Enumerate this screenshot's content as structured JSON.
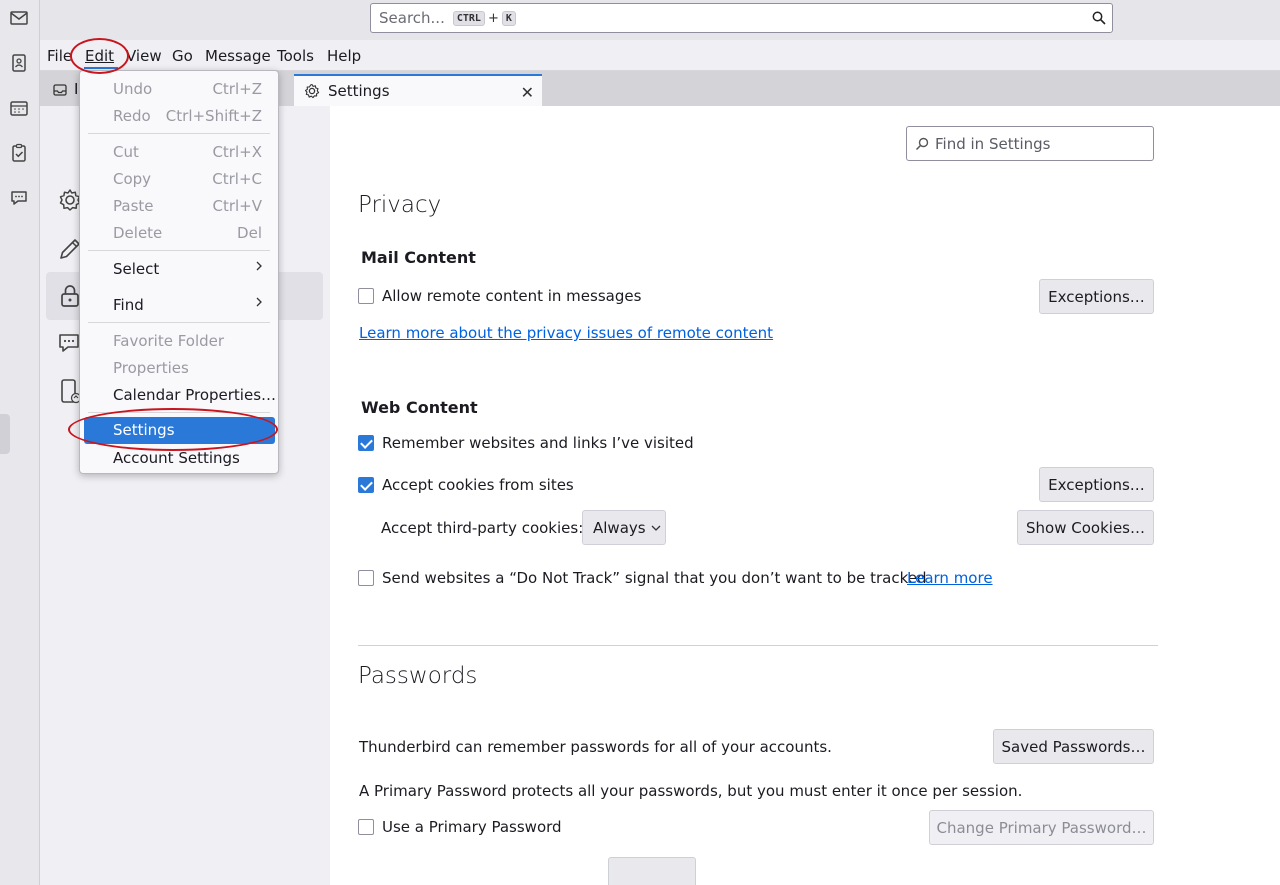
{
  "search": {
    "placeholder": "Search...",
    "key1": "CTRL",
    "plus": "+",
    "key2": "K"
  },
  "menubar": {
    "items": [
      {
        "label": "File"
      },
      {
        "label": "Edit"
      },
      {
        "label": "View"
      },
      {
        "label": "Go"
      },
      {
        "label": "Message"
      },
      {
        "label": "Tools"
      },
      {
        "label": "Help"
      }
    ]
  },
  "tabs": {
    "home_label": "I",
    "settings_label": "Settings",
    "close_glyph": "✕"
  },
  "edit_menu": {
    "undo": {
      "label": "Undo",
      "shortcut": "Ctrl+Z"
    },
    "redo": {
      "label": "Redo",
      "shortcut": "Ctrl+Shift+Z"
    },
    "cut": {
      "label": "Cut",
      "shortcut": "Ctrl+X"
    },
    "copy": {
      "label": "Copy",
      "shortcut": "Ctrl+C"
    },
    "paste": {
      "label": "Paste",
      "shortcut": "Ctrl+V"
    },
    "delete": {
      "label": "Delete",
      "shortcut": "Del"
    },
    "select": {
      "label": "Select"
    },
    "find": {
      "label": "Find"
    },
    "favorite_folder": {
      "label": "Favorite Folder"
    },
    "properties": {
      "label": "Properties"
    },
    "calendar_properties": {
      "label": "Calendar Properties…"
    },
    "settings": {
      "label": "Settings"
    },
    "account_settings": {
      "label": "Account Settings"
    }
  },
  "content": {
    "find_placeholder": "Find in Settings",
    "privacy": {
      "title": "Privacy",
      "mail_content": "Mail Content",
      "allow_remote": "Allow remote content in messages",
      "allow_remote_checked": false,
      "exceptions_label": "Exceptions…",
      "learn_more_remote": "Learn more about the privacy issues of remote content",
      "web_content": "Web Content",
      "remember_websites": "Remember websites and links I’ve visited",
      "remember_checked": true,
      "accept_cookies": "Accept cookies from sites",
      "accept_cookies_checked": true,
      "third_party_label": "Accept third-party cookies:",
      "third_party_value": "Always",
      "show_cookies": "Show Cookies…",
      "dnt_label": "Send websites a “Do Not Track” signal that you don’t want to be tracked",
      "dnt_checked": false,
      "learn_more": "Learn more"
    },
    "passwords": {
      "title": "Passwords",
      "remember_text": "Thunderbird can remember passwords for all of your accounts.",
      "saved_passwords": "Saved Passwords…",
      "primary_text": "A Primary Password protects all your passwords, but you must enter it once per session.",
      "use_primary": "Use a Primary Password",
      "use_primary_checked": false,
      "change_primary": "Change Primary Password…"
    }
  },
  "colors": {
    "accent": "#2a79d8",
    "annotation": "#c9151e",
    "link": "#0061e0"
  }
}
